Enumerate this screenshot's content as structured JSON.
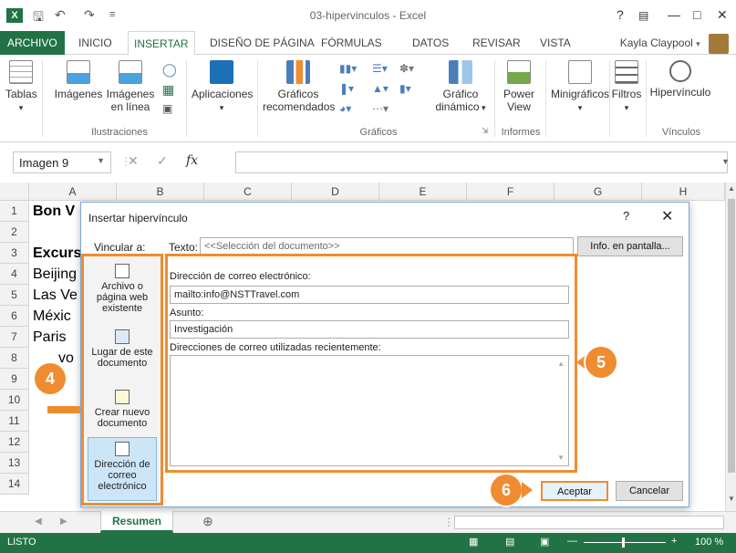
{
  "window": {
    "title": "03-hipervinculos - Excel",
    "help": "?",
    "user_name": "Kayla Claypool"
  },
  "ribbon_tabs": [
    "ARCHIVO",
    "INICIO",
    "INSERTAR",
    "DISEÑO DE PÁGINA",
    "FÓRMULAS",
    "DATOS",
    "REVISAR",
    "VISTA"
  ],
  "ribbon": {
    "tablas": "Tablas",
    "imagenes": "Imágenes",
    "imagenes_en_linea_1": "Imágenes",
    "imagenes_en_linea_2": "en línea",
    "ilustraciones": "Ilustraciones",
    "aplicaciones": "Aplicaciones",
    "graficos_rec_1": "Gráficos",
    "graficos_rec_2": "recomendados",
    "grafico_din_1": "Gráfico",
    "grafico_din_2": "dinámico",
    "graficos": "Gráficos",
    "power_view_1": "Power",
    "power_view_2": "View",
    "informes": "Informes",
    "minigraficos": "Minigráficos",
    "filtros": "Filtros",
    "hipervinculo": "Hipervínculo",
    "vinculos": "Vínculos"
  },
  "formula_bar": {
    "name_box": "Imagen 9",
    "fx": "fx"
  },
  "columns": [
    "A",
    "B",
    "C",
    "D",
    "E",
    "F",
    "G",
    "H"
  ],
  "rows": [
    {
      "num": "1",
      "text": "Bon V",
      "bold": true
    },
    {
      "num": "2",
      "text": "",
      "bold": false
    },
    {
      "num": "3",
      "text": "Excurs",
      "bold": true
    },
    {
      "num": "4",
      "text": "Beijing",
      "bold": false
    },
    {
      "num": "5",
      "text": "Las Ve",
      "bold": false
    },
    {
      "num": "6",
      "text": "Méxic",
      "bold": false
    },
    {
      "num": "7",
      "text": "Paris",
      "bold": false
    },
    {
      "num": "8",
      "text": "vo",
      "bold": false
    },
    {
      "num": "9",
      "text": "",
      "bold": false
    },
    {
      "num": "10",
      "text": "",
      "bold": false
    },
    {
      "num": "11",
      "text": "",
      "bold": false
    },
    {
      "num": "12",
      "text": "",
      "bold": false
    },
    {
      "num": "13",
      "text": "",
      "bold": false
    },
    {
      "num": "14",
      "text": "",
      "bold": false
    }
  ],
  "sheet_tab": "Resumen",
  "status": {
    "mode": "LISTO",
    "zoom": "100 %"
  },
  "dialog": {
    "title": "Insertar hipervínculo",
    "help": "?",
    "vincular_a": "Vincular a:",
    "texto_label": "Texto:",
    "texto_value": "<<Selección del documento>>",
    "info_button": "Info. en pantalla...",
    "link_options": [
      {
        "l1": "Archivo o",
        "l2": "página web",
        "l3": "existente"
      },
      {
        "l1": "Lugar de este",
        "l2": "documento",
        "l3": ""
      },
      {
        "l1": "Crear nuevo",
        "l2": "documento",
        "l3": ""
      },
      {
        "l1": "Dirección de",
        "l2": "correo",
        "l3": "electrónico"
      }
    ],
    "email_label": "Dirección de correo electrónico:",
    "email_value": "mailto:info@NSTTravel.com",
    "subject_label": "Asunto:",
    "subject_value": "Investigación",
    "recent_label": "Direcciones de correo utilizadas recientemente:",
    "ok_button": "Aceptar",
    "cancel_button": "Cancelar"
  },
  "callouts": [
    "4",
    "5",
    "6"
  ],
  "colors": {
    "excel_green": "#217346",
    "callout_orange": "#ef8c30",
    "selection_blue": "#cde6f7"
  }
}
